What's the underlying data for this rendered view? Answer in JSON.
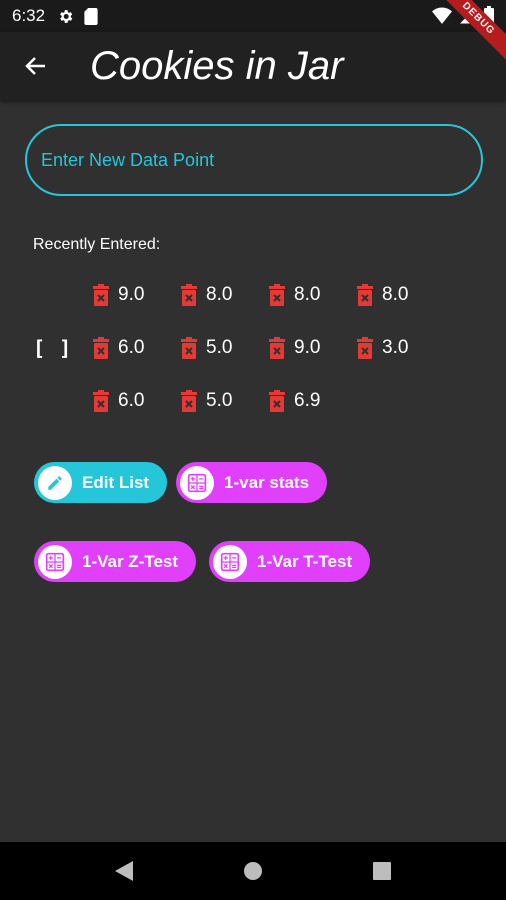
{
  "status": {
    "time": "6:32",
    "icons": [
      "gear-icon",
      "sd-card-icon",
      "wifi-icon",
      "signal-icon",
      "battery-icon"
    ]
  },
  "debug_banner": "DEBUG",
  "app_bar": {
    "title": "Cookies in Jar",
    "back_icon": "arrow-left-icon"
  },
  "input": {
    "placeholder": "Enter New Data Point",
    "value": ""
  },
  "recent": {
    "label": "Recently Entered:",
    "bracket": "[ ]",
    "items": [
      "9.0",
      "8.0",
      "8.0",
      "8.0",
      "6.0",
      "5.0",
      "9.0",
      "3.0",
      "6.0",
      "5.0",
      "6.9"
    ],
    "delete_icon": "trash-icon"
  },
  "buttons": {
    "edit_list": "Edit List",
    "one_var_stats": "1-var stats",
    "z_test": "1-Var Z-Test",
    "t_test": "1-Var T-Test"
  },
  "colors": {
    "accent_cyan": "#26c6da",
    "accent_magenta": "#e040fb",
    "delete_red": "#e53935",
    "background": "#303030",
    "app_bar": "#212121"
  },
  "nav": {
    "icons": [
      "back-triangle-icon",
      "home-circle-icon",
      "recents-square-icon"
    ]
  }
}
